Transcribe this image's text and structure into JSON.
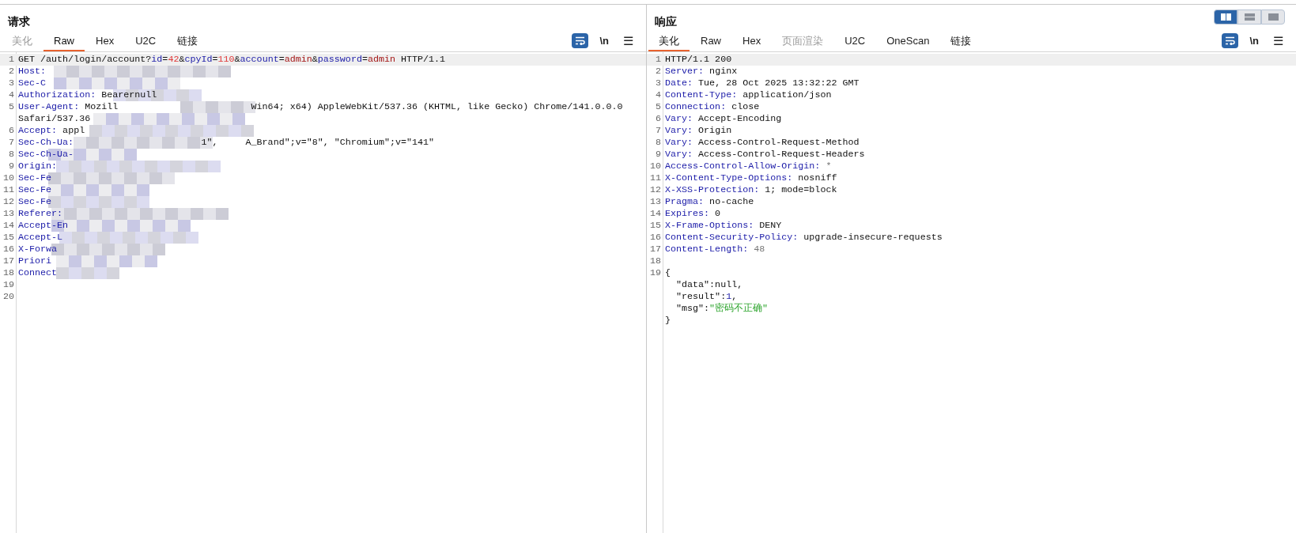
{
  "layout_toggle": [
    {
      "selected": true
    },
    {
      "selected": false
    },
    {
      "selected": false
    }
  ],
  "request": {
    "title": "请求",
    "tabs": [
      {
        "label": "美化",
        "selected": false,
        "disabled": true
      },
      {
        "label": "Raw",
        "selected": true,
        "disabled": false
      },
      {
        "label": "Hex",
        "selected": false,
        "disabled": false
      },
      {
        "label": "U2C",
        "selected": false,
        "disabled": false
      },
      {
        "label": "链接",
        "selected": false,
        "disabled": false
      }
    ],
    "toolbar": {
      "wrap_on": true,
      "newline": "\\n",
      "menu": "☰"
    },
    "lines": [
      {
        "number": "1",
        "highlighted": true,
        "parts": [
          {
            "text": "GET /auth/login/account?",
            "kind": "plain"
          },
          {
            "text": "id",
            "kind": "key"
          },
          {
            "text": "=",
            "kind": "plain"
          },
          {
            "text": "42",
            "kind": "num"
          },
          {
            "text": "&",
            "kind": "plain"
          },
          {
            "text": "cpyId",
            "kind": "key"
          },
          {
            "text": "=",
            "kind": "plain"
          },
          {
            "text": "110",
            "kind": "num"
          },
          {
            "text": "&",
            "kind": "plain"
          },
          {
            "text": "account",
            "kind": "key"
          },
          {
            "text": "=",
            "kind": "plain"
          },
          {
            "text": "admin",
            "kind": "val"
          },
          {
            "text": "&",
            "kind": "plain"
          },
          {
            "text": "password",
            "kind": "key"
          },
          {
            "text": "=",
            "kind": "plain"
          },
          {
            "text": "admin",
            "kind": "val"
          },
          {
            "text": " HTTP/1.1",
            "kind": "plain"
          }
        ]
      },
      {
        "number": "2",
        "highlighted": false,
        "parts": [
          {
            "text": "Host:",
            "kind": "key"
          }
        ]
      },
      {
        "number": "3",
        "highlighted": false,
        "parts": [
          {
            "text": "Sec-C",
            "kind": "key"
          }
        ]
      },
      {
        "number": "4",
        "highlighted": false,
        "parts": [
          {
            "text": "Authorization:",
            "kind": "key"
          },
          {
            "text": " Bearernull",
            "kind": "plain"
          }
        ]
      },
      {
        "number": "5",
        "highlighted": false,
        "parts": [
          {
            "text": "User-Agent:",
            "kind": "key"
          },
          {
            "text": " Mozill",
            "kind": "plain"
          },
          {
            "text": "Win64; x64) AppleWebKit/537.36 (KHTML, like Gecko) Chrome/141.0.0.0",
            "kind": "plain"
          },
          {
            "text": "Safari/537.36",
            "kind": "plain",
            "wrap": true
          }
        ]
      },
      {
        "number": "6",
        "highlighted": false,
        "parts": [
          {
            "text": "Accept:",
            "kind": "key"
          },
          {
            "text": " appl",
            "kind": "plain"
          }
        ]
      },
      {
        "number": "7",
        "highlighted": false,
        "parts": [
          {
            "text": "Sec-Ch-Ua:",
            "kind": "key"
          },
          {
            "text": "1\",",
            "kind": "plain"
          },
          {
            "text": "A_Brand\";v=\"8\", \"Chromium\";v=\"141\"",
            "kind": "plain"
          }
        ]
      },
      {
        "number": "8",
        "highlighted": false,
        "parts": [
          {
            "text": "Sec-Ch-Ua-",
            "kind": "key"
          }
        ]
      },
      {
        "number": "9",
        "highlighted": false,
        "parts": [
          {
            "text": "Origin:",
            "kind": "key"
          }
        ]
      },
      {
        "number": "10",
        "highlighted": false,
        "parts": [
          {
            "text": "Sec-Fe",
            "kind": "key"
          }
        ]
      },
      {
        "number": "11",
        "highlighted": false,
        "parts": [
          {
            "text": "Sec-Fe",
            "kind": "key"
          }
        ]
      },
      {
        "number": "12",
        "highlighted": false,
        "parts": [
          {
            "text": "Sec-Fe",
            "kind": "key"
          }
        ]
      },
      {
        "number": "13",
        "highlighted": false,
        "parts": [
          {
            "text": "Referer:",
            "kind": "key"
          }
        ]
      },
      {
        "number": "14",
        "highlighted": false,
        "parts": [
          {
            "text": "Accept-En",
            "kind": "key"
          }
        ]
      },
      {
        "number": "15",
        "highlighted": false,
        "parts": [
          {
            "text": "Accept-L",
            "kind": "key"
          }
        ]
      },
      {
        "number": "16",
        "highlighted": false,
        "parts": [
          {
            "text": "X-Forwa",
            "kind": "key"
          }
        ]
      },
      {
        "number": "17",
        "highlighted": false,
        "parts": [
          {
            "text": "Priori",
            "kind": "key"
          }
        ]
      },
      {
        "number": "18",
        "highlighted": false,
        "parts": [
          {
            "text": "Connect",
            "kind": "key"
          }
        ]
      },
      {
        "number": "19",
        "highlighted": false
      },
      {
        "number": "20",
        "highlighted": false
      }
    ]
  },
  "response": {
    "title": "响应",
    "tabs": [
      {
        "label": "美化",
        "selected": true,
        "disabled": false
      },
      {
        "label": "Raw",
        "selected": false,
        "disabled": false
      },
      {
        "label": "Hex",
        "selected": false,
        "disabled": false
      },
      {
        "label": "页面渲染",
        "selected": false,
        "disabled": true
      },
      {
        "label": "U2C",
        "selected": false,
        "disabled": false
      },
      {
        "label": "OneScan",
        "selected": false,
        "disabled": false
      },
      {
        "label": "链接",
        "selected": false,
        "disabled": false
      }
    ],
    "toolbar": {
      "wrap_on": true,
      "newline": "\\n",
      "menu": "☰"
    },
    "lines": [
      {
        "number": "1",
        "highlighted": true,
        "parts": [
          {
            "text": "HTTP/1.1 200",
            "kind": "plain"
          }
        ]
      },
      {
        "number": "2",
        "highlighted": false,
        "parts": [
          {
            "text": "Server:",
            "kind": "key"
          },
          {
            "text": " nginx",
            "kind": "plain"
          }
        ]
      },
      {
        "number": "3",
        "highlighted": false,
        "parts": [
          {
            "text": "Date:",
            "kind": "key"
          },
          {
            "text": " Tue, 28 Oct 2025 13:32:22 GMT",
            "kind": "plain"
          }
        ]
      },
      {
        "number": "4",
        "highlighted": false,
        "parts": [
          {
            "text": "Content-Type:",
            "kind": "key"
          },
          {
            "text": " application/json",
            "kind": "plain"
          }
        ]
      },
      {
        "number": "5",
        "highlighted": false,
        "parts": [
          {
            "text": "Connection:",
            "kind": "key"
          },
          {
            "text": " close",
            "kind": "plain"
          }
        ]
      },
      {
        "number": "6",
        "highlighted": false,
        "parts": [
          {
            "text": "Vary:",
            "kind": "key"
          },
          {
            "text": " Accept-Encoding",
            "kind": "plain"
          }
        ]
      },
      {
        "number": "7",
        "highlighted": false,
        "parts": [
          {
            "text": "Vary:",
            "kind": "key"
          },
          {
            "text": " Origin",
            "kind": "plain"
          }
        ]
      },
      {
        "number": "8",
        "highlighted": false,
        "parts": [
          {
            "text": "Vary:",
            "kind": "key"
          },
          {
            "text": " Access-Control-Request-Method",
            "kind": "plain"
          }
        ]
      },
      {
        "number": "9",
        "highlighted": false,
        "parts": [
          {
            "text": "Vary:",
            "kind": "key"
          },
          {
            "text": " Access-Control-Request-Headers",
            "kind": "plain"
          }
        ]
      },
      {
        "number": "10",
        "highlighted": false,
        "parts": [
          {
            "text": "Access-Control-Allow-Origin:",
            "kind": "key"
          },
          {
            "text": " *",
            "kind": "muted"
          }
        ]
      },
      {
        "number": "11",
        "highlighted": false,
        "parts": [
          {
            "text": "X-Content-Type-Options:",
            "kind": "key"
          },
          {
            "text": " nosniff",
            "kind": "plain"
          }
        ]
      },
      {
        "number": "12",
        "highlighted": false,
        "parts": [
          {
            "text": "X-XSS-Protection:",
            "kind": "key"
          },
          {
            "text": " 1; mode=block",
            "kind": "plain"
          }
        ]
      },
      {
        "number": "13",
        "highlighted": false,
        "parts": [
          {
            "text": "Pragma:",
            "kind": "key"
          },
          {
            "text": " no-cache",
            "kind": "plain"
          }
        ]
      },
      {
        "number": "14",
        "highlighted": false,
        "parts": [
          {
            "text": "Expires:",
            "kind": "key"
          },
          {
            "text": " 0",
            "kind": "plain"
          }
        ]
      },
      {
        "number": "15",
        "highlighted": false,
        "parts": [
          {
            "text": "X-Frame-Options:",
            "kind": "key"
          },
          {
            "text": " DENY",
            "kind": "plain"
          }
        ]
      },
      {
        "number": "16",
        "highlighted": false,
        "parts": [
          {
            "text": "Content-Security-Policy:",
            "kind": "key"
          },
          {
            "text": " upgrade-insecure-requests",
            "kind": "plain"
          }
        ]
      },
      {
        "number": "17",
        "highlighted": false,
        "parts": [
          {
            "text": "Content-Length:",
            "kind": "key"
          },
          {
            "text": " 48",
            "kind": "muted"
          }
        ]
      },
      {
        "number": "18",
        "highlighted": false
      },
      {
        "number": "19",
        "highlighted": false,
        "parts": [
          {
            "text": "{",
            "kind": "plain"
          }
        ]
      },
      {
        "highlighted": false,
        "parts": [
          {
            "text": "  \"data\":null,",
            "kind": "plain"
          }
        ]
      },
      {
        "highlighted": false,
        "parts": [
          {
            "text": "  \"result\":",
            "kind": "plain"
          },
          {
            "text": "1",
            "kind": "jnum"
          },
          {
            "text": ",",
            "kind": "plain"
          }
        ]
      },
      {
        "highlighted": false,
        "parts": [
          {
            "text": "  \"msg\":",
            "kind": "plain"
          },
          {
            "text": "\"密码不正确\"",
            "kind": "str"
          }
        ]
      },
      {
        "highlighted": false,
        "parts": [
          {
            "text": "}",
            "kind": "plain"
          }
        ]
      }
    ]
  }
}
